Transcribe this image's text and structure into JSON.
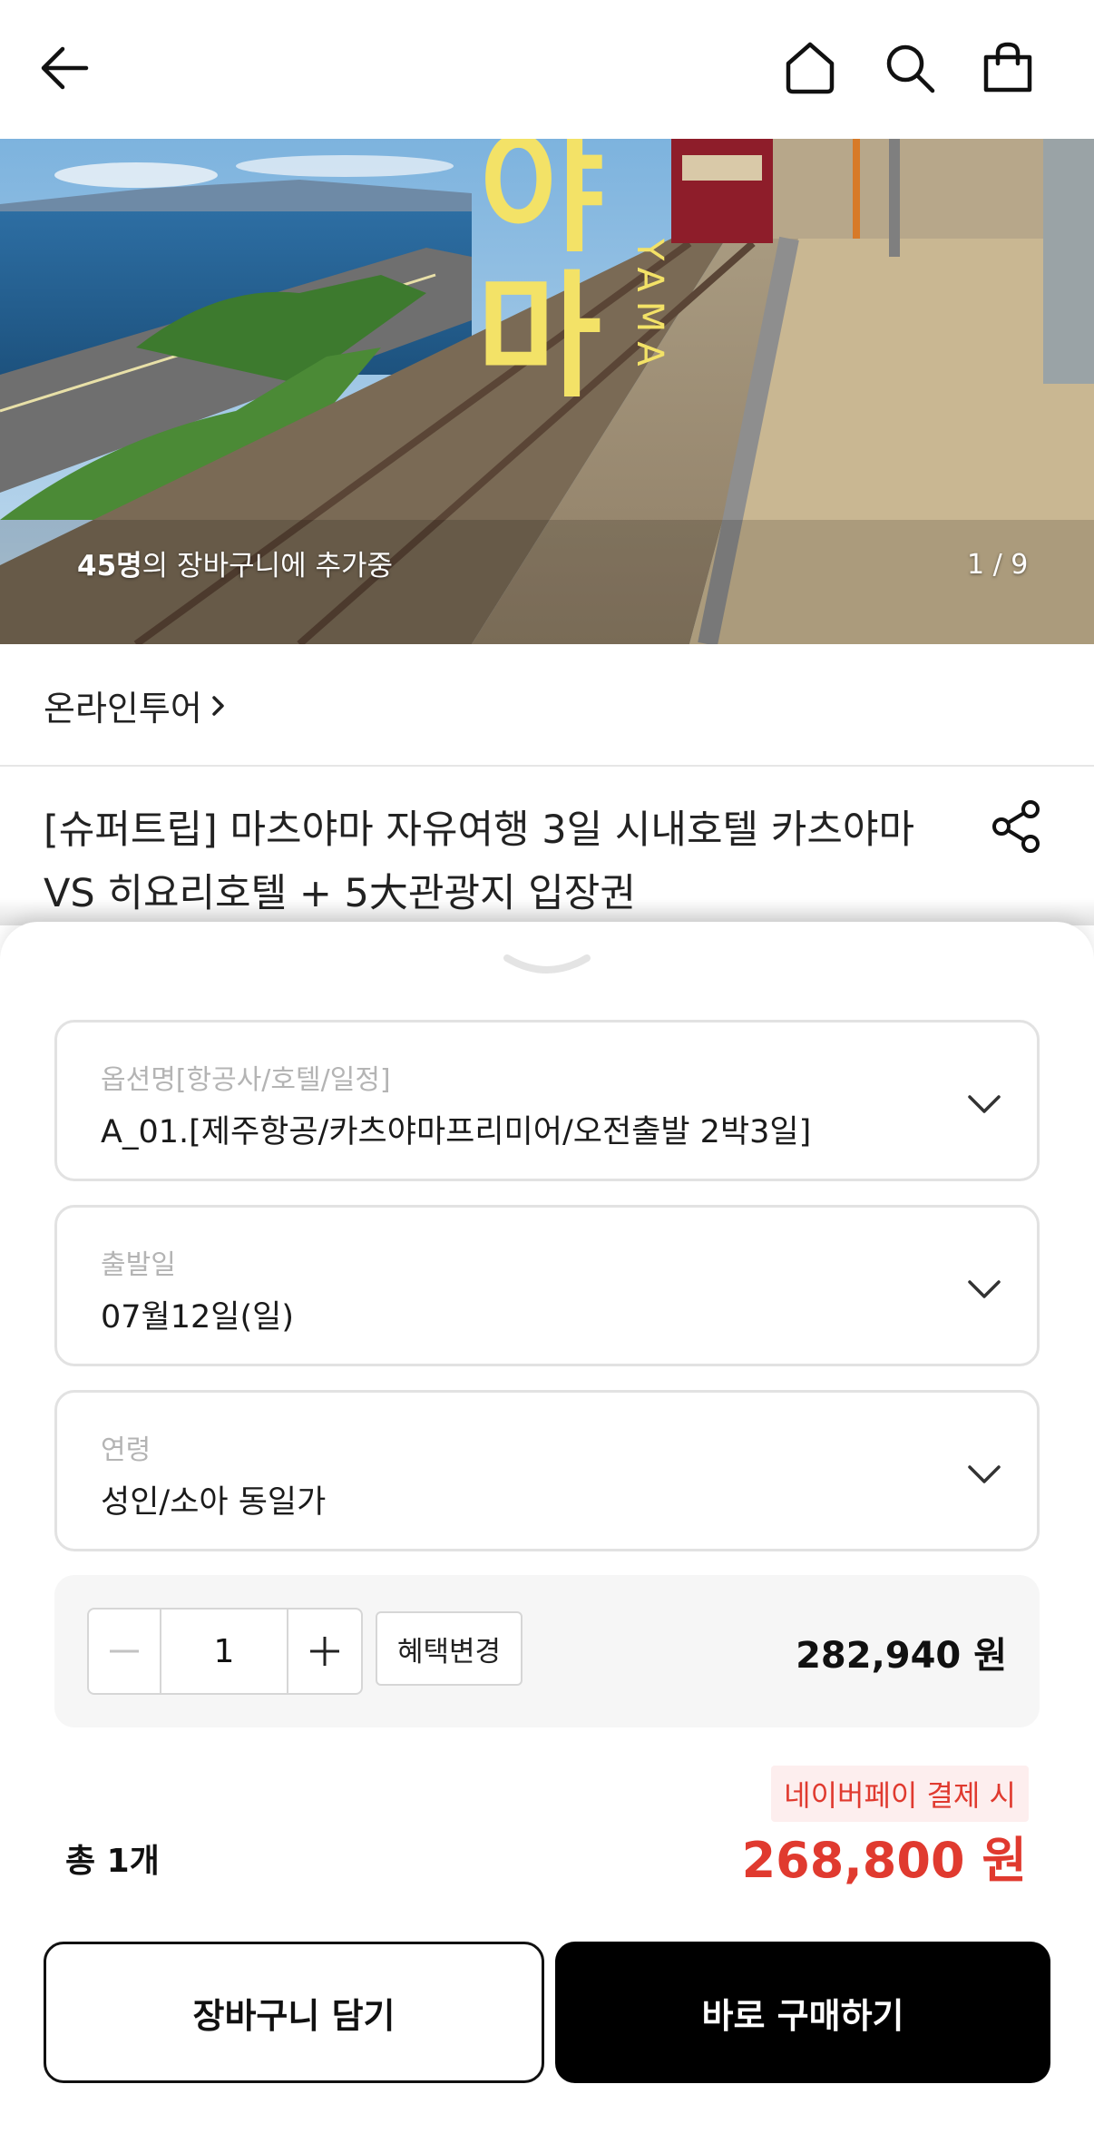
{
  "icons": {
    "back": "arrow-left-icon",
    "home": "home-icon",
    "search": "search-icon",
    "bag": "shopping-bag-icon",
    "share": "share-icon",
    "category_arrow": "chevron-right-icon",
    "sheet_handle": "chevron-down-icon",
    "select_arrow": "chevron-down-icon",
    "minus": "minus-icon",
    "plus": "plus-icon"
  },
  "hero": {
    "cart_count_number": "45명",
    "cart_count_text": "의 장바구니에 추가중",
    "pager": "1 / 9",
    "overlay_big_text": "야마",
    "overlay_small_text": "YAMA"
  },
  "category": {
    "label": "온라인투어"
  },
  "product": {
    "title": "[슈퍼트립] 마츠야마 자유여행 3일 시내호텔 카츠야마 VS 히요리호텔 + 5大관광지 입장권"
  },
  "options": [
    {
      "label": "옵션명[항공사/호텔/일정]",
      "value": "A_01.[제주항공/카츠야마프리미어/오전출발 2박3일]"
    },
    {
      "label": "출발일",
      "value": "07월12일(일)"
    },
    {
      "label": "연령",
      "value": "성인/소아 동일가"
    }
  ],
  "quantity": {
    "value": "1",
    "benefit_button": "혜택변경",
    "price": "282,940 원"
  },
  "summary": {
    "naverpay_note": "네이버페이 결제 시",
    "total_label": "총 1개",
    "total_price": "268,800 원"
  },
  "actions": {
    "add_to_cart": "장바구니 담기",
    "buy_now": "바로 구매하기"
  },
  "colors": {
    "accent_red": "#e03a2f",
    "naverpay_bg": "#fdeeee",
    "primary_button": "#000000"
  }
}
